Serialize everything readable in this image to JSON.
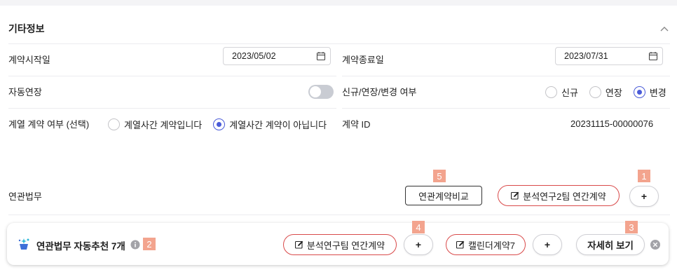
{
  "section": {
    "title": "기타정보"
  },
  "fields": {
    "contract_start": {
      "label": "계약시작일",
      "value": "2023/05/02"
    },
    "contract_end": {
      "label": "계약종료일",
      "value": "2023/07/31"
    },
    "auto_renew": {
      "label": "자동연장",
      "checked": false
    },
    "change_type": {
      "label": "신규/연장/변경 여부",
      "options": [
        "신규",
        "연장",
        "변경"
      ],
      "selected": "변경"
    },
    "affiliate": {
      "label": "계열 계약 여부 (선택)",
      "options": [
        "계열사간 계약입니다",
        "계열사간 계약이 아닙니다"
      ],
      "selected": "계열사간 계약이 아닙니다"
    },
    "contract_id": {
      "label": "계약 ID",
      "value": "20231115-00000076"
    }
  },
  "related": {
    "label": "연관법무",
    "compare_label": "연관계약비교",
    "item_label": "분석연구2팀 연간계약",
    "add_label": "+"
  },
  "recommend": {
    "title": "연관법무 자동추천 7개",
    "items": [
      {
        "label": "분석연구팀 연간계약"
      },
      {
        "label": "캘린더계약7"
      }
    ],
    "add_label": "+",
    "detail_label": "자세히 보기"
  },
  "badges": [
    "1",
    "2",
    "3",
    "4",
    "5"
  ],
  "colors": {
    "accent": "#4a5bd8",
    "pill_border": "#d94a4a",
    "badge": "#f3a48e"
  }
}
